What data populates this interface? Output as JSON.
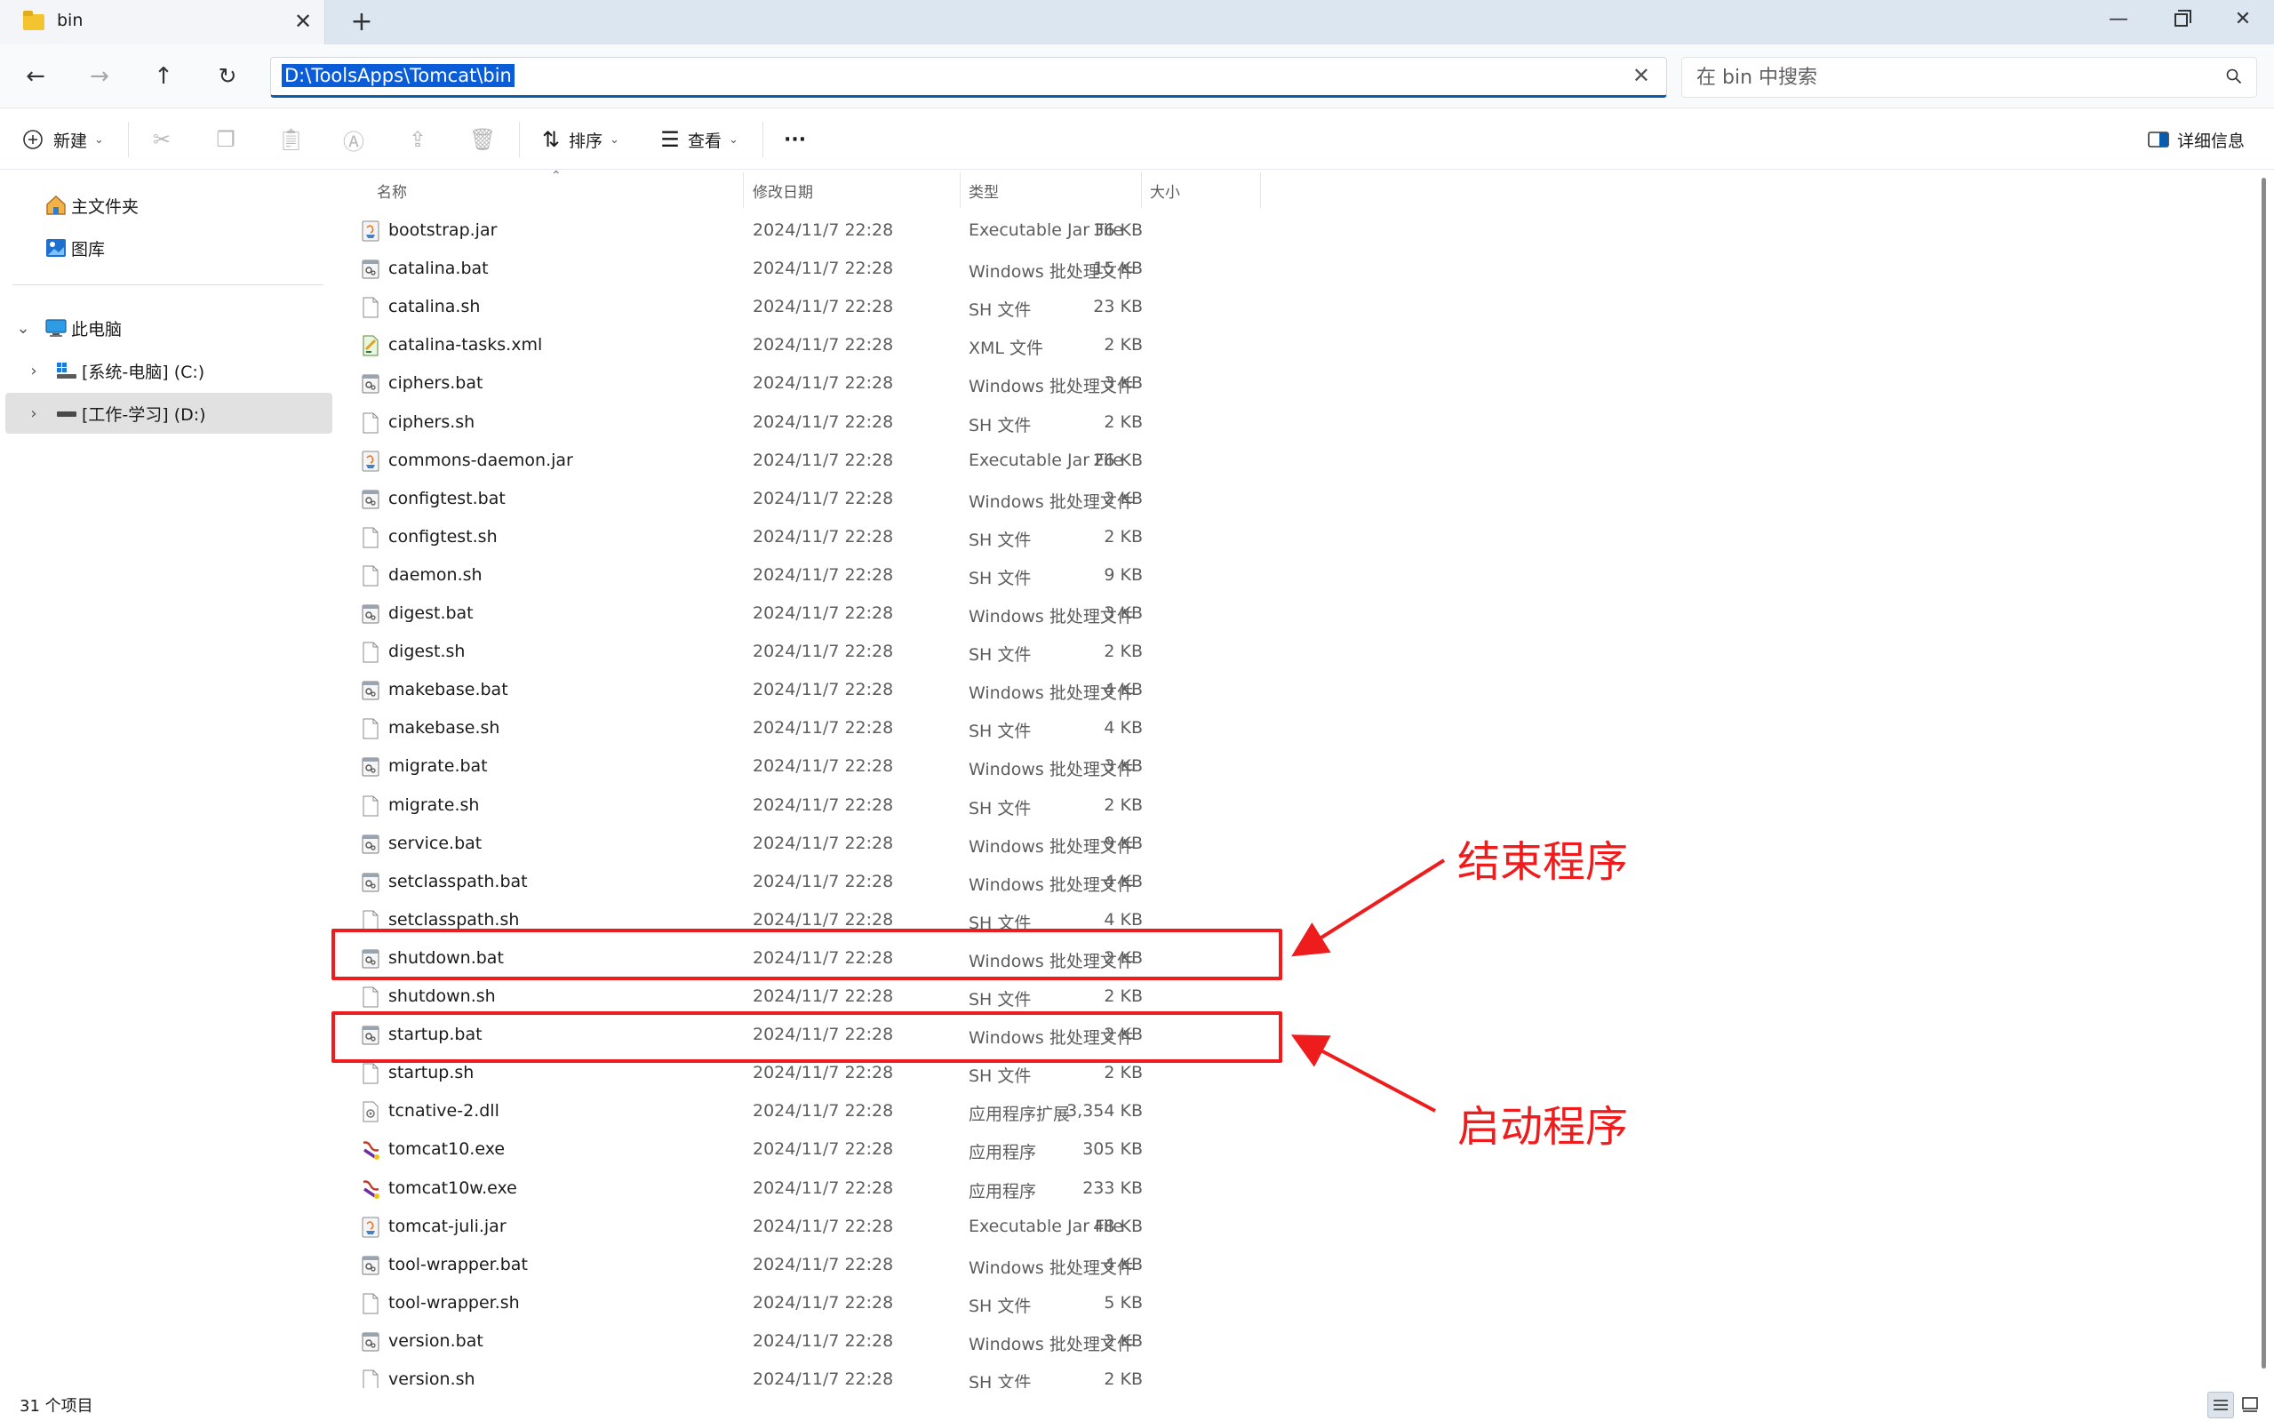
{
  "window": {
    "tab_title": "bin",
    "tab_close": "✕",
    "new_tab": "+",
    "minimize": "—",
    "close": "✕"
  },
  "nav": {
    "back": "←",
    "forward": "→",
    "up": "↑",
    "refresh": "↻"
  },
  "address": {
    "path": "D:\\ToolsApps\\Tomcat\\bin",
    "clear": "✕"
  },
  "search": {
    "placeholder": "在 bin 中搜索"
  },
  "toolbar": {
    "new_label": "新建",
    "sort_label": "排序",
    "view_label": "查看",
    "more_label": "···",
    "details_label": "详细信息"
  },
  "sidebar": {
    "home": "主文件夹",
    "gallery": "图库",
    "this_pc": "此电脑",
    "drive_c": "[系统-电脑] (C:)",
    "drive_d": "[工作-学习] (D:)"
  },
  "columns": {
    "name": "名称",
    "modified": "修改日期",
    "type": "类型",
    "size": "大小"
  },
  "files": [
    {
      "name": "bootstrap.jar",
      "date": "2024/11/7 22:28",
      "type": "Executable Jar File",
      "size": "36 KB",
      "icon": "jar"
    },
    {
      "name": "catalina.bat",
      "date": "2024/11/7 22:28",
      "type": "Windows 批处理文件",
      "size": "15 KB",
      "icon": "bat"
    },
    {
      "name": "catalina.sh",
      "date": "2024/11/7 22:28",
      "type": "SH 文件",
      "size": "23 KB",
      "icon": "file"
    },
    {
      "name": "catalina-tasks.xml",
      "date": "2024/11/7 22:28",
      "type": "XML 文件",
      "size": "2 KB",
      "icon": "xml"
    },
    {
      "name": "ciphers.bat",
      "date": "2024/11/7 22:28",
      "type": "Windows 批处理文件",
      "size": "3 KB",
      "icon": "bat"
    },
    {
      "name": "ciphers.sh",
      "date": "2024/11/7 22:28",
      "type": "SH 文件",
      "size": "2 KB",
      "icon": "file"
    },
    {
      "name": "commons-daemon.jar",
      "date": "2024/11/7 22:28",
      "type": "Executable Jar File",
      "size": "26 KB",
      "icon": "jar"
    },
    {
      "name": "configtest.bat",
      "date": "2024/11/7 22:28",
      "type": "Windows 批处理文件",
      "size": "2 KB",
      "icon": "bat"
    },
    {
      "name": "configtest.sh",
      "date": "2024/11/7 22:28",
      "type": "SH 文件",
      "size": "2 KB",
      "icon": "file"
    },
    {
      "name": "daemon.sh",
      "date": "2024/11/7 22:28",
      "type": "SH 文件",
      "size": "9 KB",
      "icon": "file"
    },
    {
      "name": "digest.bat",
      "date": "2024/11/7 22:28",
      "type": "Windows 批处理文件",
      "size": "3 KB",
      "icon": "bat"
    },
    {
      "name": "digest.sh",
      "date": "2024/11/7 22:28",
      "type": "SH 文件",
      "size": "2 KB",
      "icon": "file"
    },
    {
      "name": "makebase.bat",
      "date": "2024/11/7 22:28",
      "type": "Windows 批处理文件",
      "size": "4 KB",
      "icon": "bat"
    },
    {
      "name": "makebase.sh",
      "date": "2024/11/7 22:28",
      "type": "SH 文件",
      "size": "4 KB",
      "icon": "file"
    },
    {
      "name": "migrate.bat",
      "date": "2024/11/7 22:28",
      "type": "Windows 批处理文件",
      "size": "3 KB",
      "icon": "bat"
    },
    {
      "name": "migrate.sh",
      "date": "2024/11/7 22:28",
      "type": "SH 文件",
      "size": "2 KB",
      "icon": "file"
    },
    {
      "name": "service.bat",
      "date": "2024/11/7 22:28",
      "type": "Windows 批处理文件",
      "size": "9 KB",
      "icon": "bat"
    },
    {
      "name": "setclasspath.bat",
      "date": "2024/11/7 22:28",
      "type": "Windows 批处理文件",
      "size": "4 KB",
      "icon": "bat"
    },
    {
      "name": "setclasspath.sh",
      "date": "2024/11/7 22:28",
      "type": "SH 文件",
      "size": "4 KB",
      "icon": "file"
    },
    {
      "name": "shutdown.bat",
      "date": "2024/11/7 22:28",
      "type": "Windows 批处理文件",
      "size": "2 KB",
      "icon": "bat"
    },
    {
      "name": "shutdown.sh",
      "date": "2024/11/7 22:28",
      "type": "SH 文件",
      "size": "2 KB",
      "icon": "file"
    },
    {
      "name": "startup.bat",
      "date": "2024/11/7 22:28",
      "type": "Windows 批处理文件",
      "size": "2 KB",
      "icon": "bat"
    },
    {
      "name": "startup.sh",
      "date": "2024/11/7 22:28",
      "type": "SH 文件",
      "size": "2 KB",
      "icon": "file"
    },
    {
      "name": "tcnative-2.dll",
      "date": "2024/11/7 22:28",
      "type": "应用程序扩展",
      "size": "3,354 KB",
      "icon": "dll"
    },
    {
      "name": "tomcat10.exe",
      "date": "2024/11/7 22:28",
      "type": "应用程序",
      "size": "305 KB",
      "icon": "exe"
    },
    {
      "name": "tomcat10w.exe",
      "date": "2024/11/7 22:28",
      "type": "应用程序",
      "size": "233 KB",
      "icon": "exe"
    },
    {
      "name": "tomcat-juli.jar",
      "date": "2024/11/7 22:28",
      "type": "Executable Jar File",
      "size": "48 KB",
      "icon": "jar"
    },
    {
      "name": "tool-wrapper.bat",
      "date": "2024/11/7 22:28",
      "type": "Windows 批处理文件",
      "size": "4 KB",
      "icon": "bat"
    },
    {
      "name": "tool-wrapper.sh",
      "date": "2024/11/7 22:28",
      "type": "SH 文件",
      "size": "5 KB",
      "icon": "file"
    },
    {
      "name": "version.bat",
      "date": "2024/11/7 22:28",
      "type": "Windows 批处理文件",
      "size": "2 KB",
      "icon": "bat"
    },
    {
      "name": "version.sh",
      "date": "2024/11/7 22:28",
      "type": "SH 文件",
      "size": "2 KB",
      "icon": "file"
    }
  ],
  "annotations": {
    "shutdown_label": "结束程序",
    "startup_label": "启动程序",
    "color": "#ee1c1c"
  },
  "status": {
    "count": "31 个项目"
  }
}
